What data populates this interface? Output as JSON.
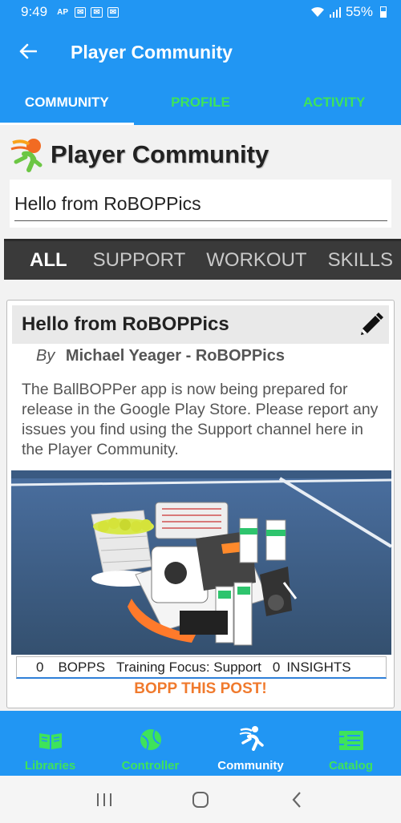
{
  "status": {
    "time": "9:49",
    "ap_label": "AP",
    "battery": "55%"
  },
  "appbar": {
    "title": "Player Community"
  },
  "tabs": [
    {
      "label": "COMMUNITY",
      "active": true
    },
    {
      "label": "PROFILE",
      "active": false
    },
    {
      "label": "ACTIVITY",
      "active": false
    }
  ],
  "page": {
    "title": "Player Community"
  },
  "search": {
    "value": "Hello from RoBOPPics"
  },
  "categories": [
    {
      "label": "ALL",
      "active": true
    },
    {
      "label": "SUPPORT",
      "active": false
    },
    {
      "label": "WORKOUT",
      "active": false
    },
    {
      "label": "SKILLS",
      "active": false
    }
  ],
  "post": {
    "title": "Hello from RoBOPPics",
    "by_label": "By",
    "author": "Michael Yeager - RoBOPPics",
    "body": "The BallBOPPer app is now being prepared for release in the Google Play Store. Please report any issues you find using the Support channel here in the Player Community.",
    "bopps_count": "0",
    "bopps_label": "BOPPS",
    "training_focus": "Training Focus: Support",
    "insights_count": "0",
    "insights_label": "INSIGHTS",
    "bopp_button": "BOPP THIS POST!"
  },
  "bottom_nav": [
    {
      "label": "Libraries",
      "icon": "book-icon",
      "active": false
    },
    {
      "label": "Controller",
      "icon": "tennis-ball-icon",
      "active": false
    },
    {
      "label": "Community",
      "icon": "player-icon",
      "active": true
    },
    {
      "label": "Catalog",
      "icon": "catalog-icon",
      "active": false
    }
  ],
  "colors": {
    "primary": "#2196f3",
    "accent_green": "#3ee35b",
    "bopp_orange": "#f07a2d",
    "category_bar": "#3a3a3a"
  }
}
